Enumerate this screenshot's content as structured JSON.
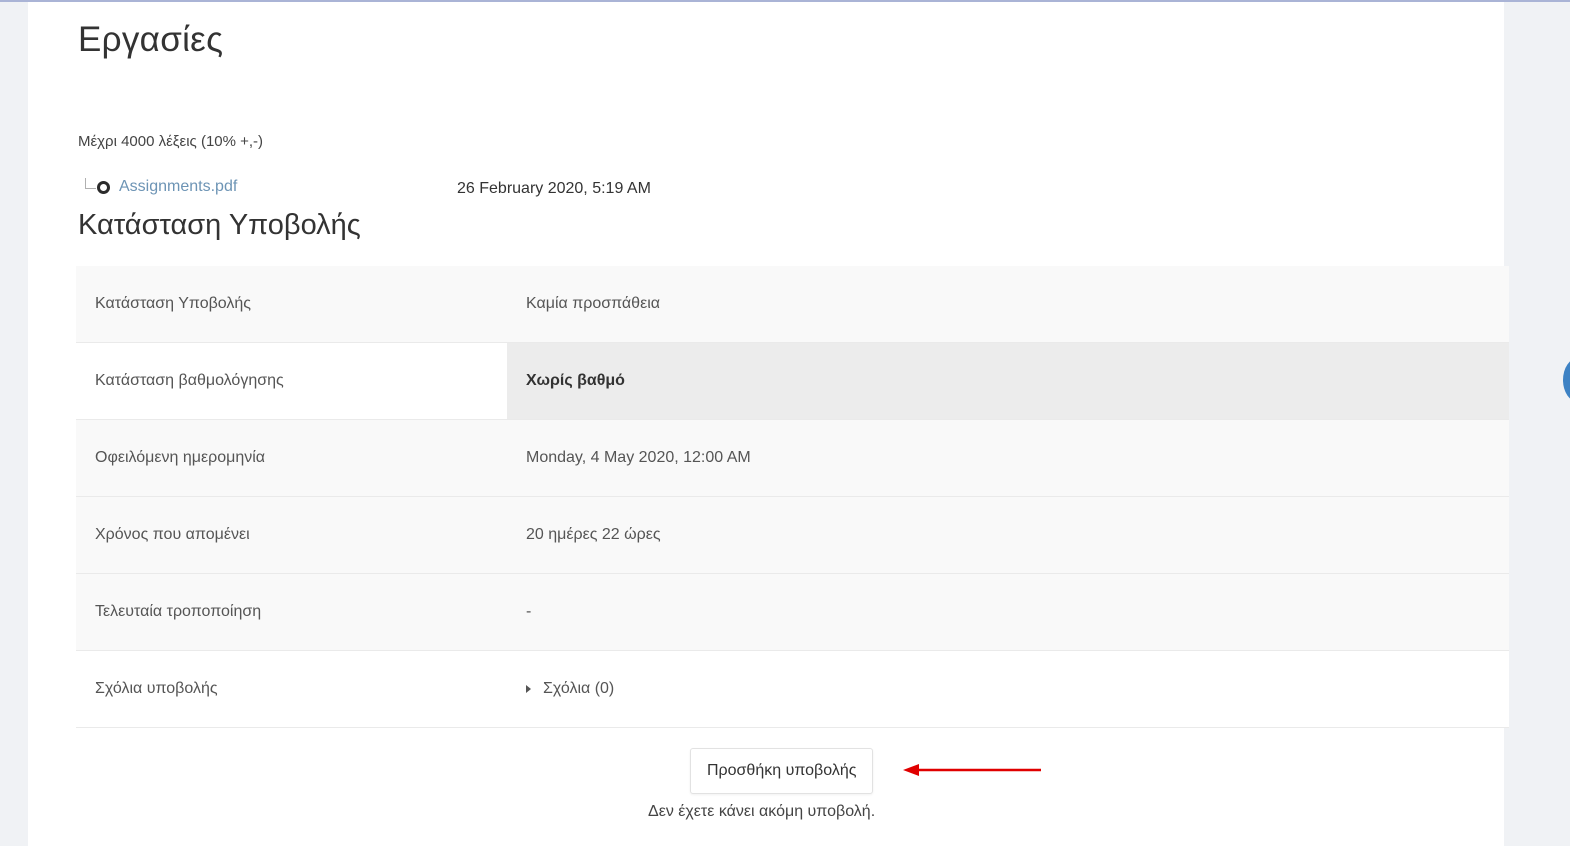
{
  "page": {
    "title": "Εργασίες",
    "intro": "Μέχρι 4000 λέξεις (10% +,-)"
  },
  "attachment": {
    "filename": "Assignments.pdf",
    "date": "26 February 2020, 5:19 AM",
    "icon": "file-pdf-icon"
  },
  "submission_status": {
    "heading": "Κατάσταση Υποβολής",
    "rows": [
      {
        "label": "Κατάσταση Υποβολής",
        "value": "Καμία προσπάθεια"
      },
      {
        "label": "Κατάσταση βαθμολόγησης",
        "value": "Χωρίς βαθμό"
      },
      {
        "label": "Οφειλόμενη ημερομηνία",
        "value": "Monday, 4 May 2020, 12:00 AM"
      },
      {
        "label": "Χρόνος που απομένει",
        "value": "20 ημέρες 22 ώρες"
      },
      {
        "label": "Τελευταία τροποποίηση",
        "value": "-"
      },
      {
        "label": "Σχόλια υποβολής",
        "value": "Σχόλια (0)"
      }
    ]
  },
  "actions": {
    "add_submission_label": "Προσθήκη υποβολής",
    "no_submission_text": "Δεν έχετε κάνει ακόμη υποβολή."
  },
  "colors": {
    "link": "#6d94b5",
    "highlight_cell": "#ececec",
    "annotation_arrow": "#e00000"
  }
}
